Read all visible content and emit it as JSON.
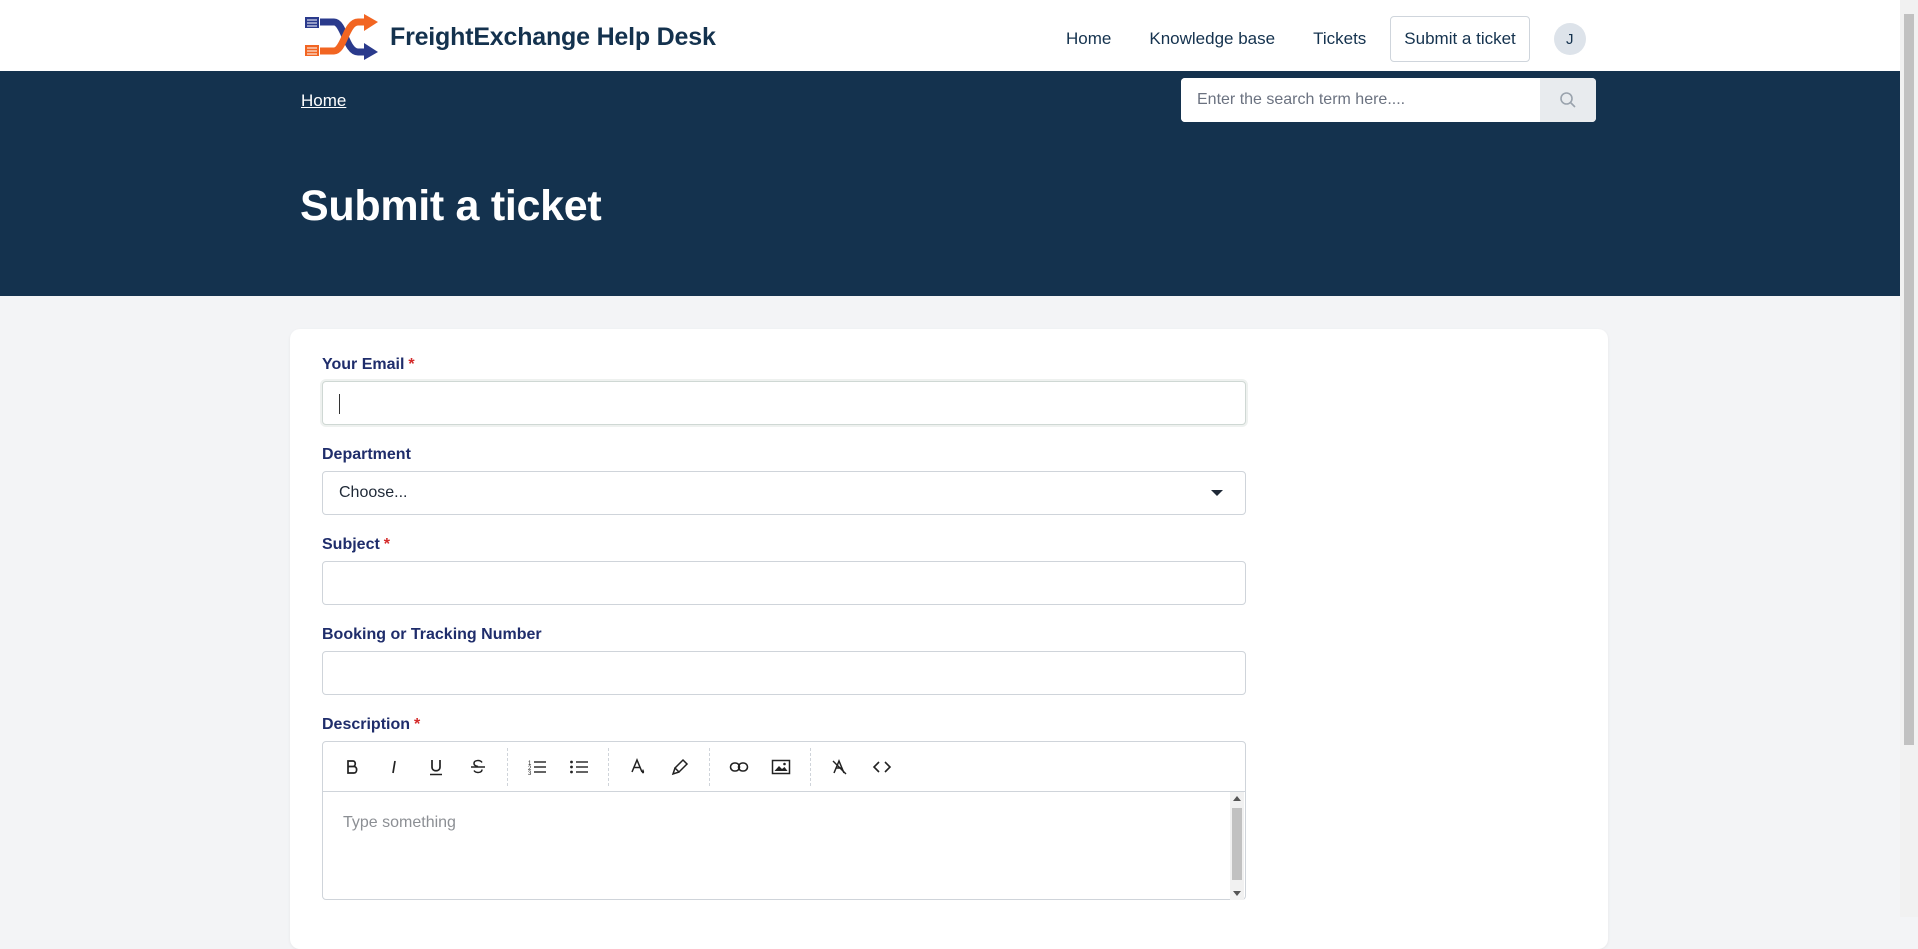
{
  "header": {
    "brand_name": "FreightExchange Help Desk",
    "nav": [
      "Home",
      "Knowledge base",
      "Tickets"
    ],
    "submit_button": "Submit a ticket",
    "avatar_initial": "J"
  },
  "hero": {
    "breadcrumb": "Home",
    "search_placeholder": "Enter the search term here....",
    "title": "Submit a ticket"
  },
  "form": {
    "email": {
      "label": "Your Email",
      "required_mark": "*",
      "value": ""
    },
    "department": {
      "label": "Department",
      "selected": "Choose..."
    },
    "subject": {
      "label": "Subject",
      "required_mark": "*",
      "value": ""
    },
    "booking": {
      "label": "Booking or Tracking Number",
      "value": ""
    },
    "description": {
      "label": "Description",
      "required_mark": "*",
      "placeholder": "Type something",
      "toolbar_icons": [
        "bold-icon",
        "italic-icon",
        "underline-icon",
        "strikethrough-icon",
        "ordered-list-icon",
        "bullet-list-icon",
        "text-color-icon",
        "highlight-icon",
        "link-icon",
        "image-icon",
        "clear-format-icon",
        "code-view-icon"
      ]
    }
  },
  "colors": {
    "navy": "#14324e",
    "label": "#1f2d6b",
    "required": "#d42a2a",
    "logo_orange": "#f26522",
    "logo_blue": "#2a3a8c"
  }
}
